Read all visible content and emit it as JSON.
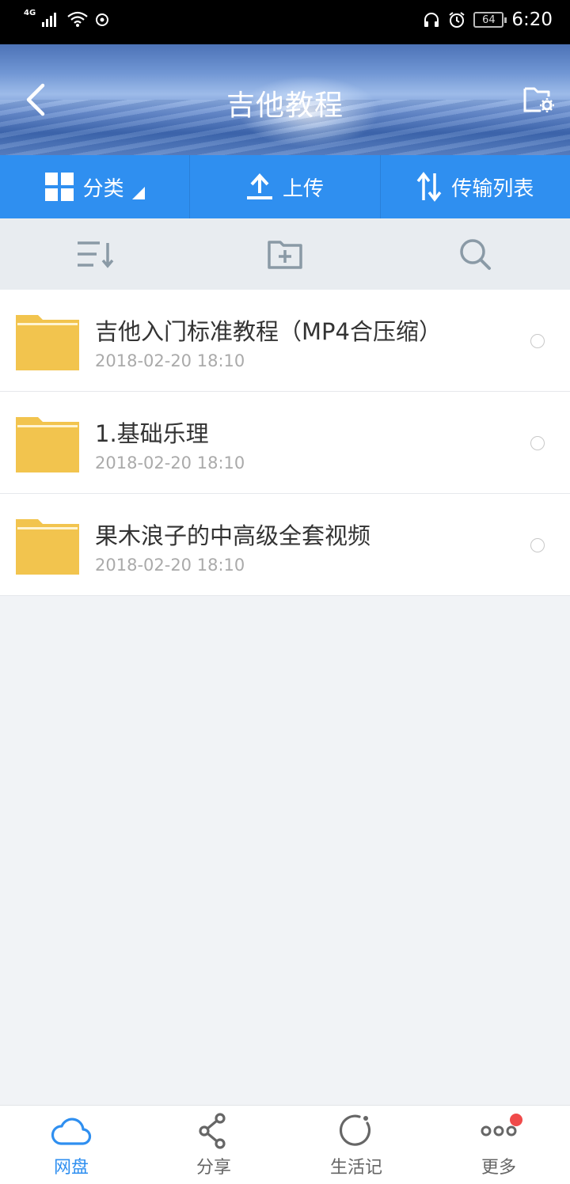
{
  "status_bar": {
    "network": "4G",
    "battery": "64",
    "time": "6:20"
  },
  "header": {
    "title": "吉他教程"
  },
  "toolbar": {
    "category_label": "分类",
    "upload_label": "上传",
    "transfer_list_label": "传输列表"
  },
  "files": [
    {
      "name": "吉他入门标准教程（MP4合压缩）",
      "date": "2018-02-20  18:10"
    },
    {
      "name": "1.基础乐理",
      "date": "2018-02-20  18:10"
    },
    {
      "name": "果木浪子的中高级全套视频",
      "date": "2018-02-20  18:10"
    }
  ],
  "bottom_nav": [
    {
      "label": "网盘",
      "active": true
    },
    {
      "label": "分享",
      "active": false
    },
    {
      "label": "生活记",
      "active": false
    },
    {
      "label": "更多",
      "active": false
    }
  ],
  "colors": {
    "accent": "#2f8ff0",
    "folder": "#f2c44e",
    "badge": "#f04a4a"
  }
}
